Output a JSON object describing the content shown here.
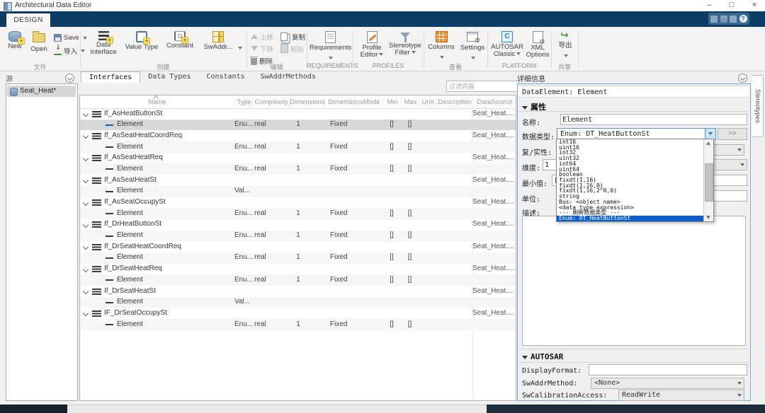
{
  "window": {
    "title": "Architectural Data Editor",
    "controls": {
      "minimize": "–",
      "maximize": "□",
      "close": "×"
    }
  },
  "ribbon": {
    "tab_label": "DESIGN",
    "groups": {
      "file": {
        "label": "文件",
        "new": "New",
        "open": "Open",
        "save": "Save",
        "import": "导入"
      },
      "create": {
        "label": "创建",
        "buttons": [
          {
            "label": "Data Interface",
            "icon": "data-interface-icon"
          },
          {
            "label": "Value Type",
            "icon": "value-type-icon"
          },
          {
            "label": "Constant",
            "icon": "constant-icon"
          },
          {
            "label": "SwAddr...",
            "icon": "swaddr-icon"
          }
        ]
      },
      "edit": {
        "label": "编辑",
        "up": "上移",
        "down": "下移",
        "copy": "复制",
        "paste": "粘贴",
        "delete": "删除"
      },
      "requirements": {
        "label": "REQUIREMENTS",
        "button": "Requirements"
      },
      "profiles": {
        "label": "PROFILES",
        "profile_editor_line1": "Profile",
        "profile_editor_line2": "Editor",
        "stereotype_filter_line1": "Stereotype",
        "stereotype_filter_line2": "Filter"
      },
      "view": {
        "label": "查看",
        "columns": "Columns",
        "settings": "Settings"
      },
      "platform": {
        "label": "PLATFORM",
        "autosar_line1": "AUTOSAR",
        "autosar_line2": "Classic",
        "xml_line1": "XML",
        "xml_line2": "Options"
      },
      "share": {
        "label": "共享",
        "export": "导出"
      }
    }
  },
  "source_panel": {
    "header": "源",
    "items": [
      {
        "label": "Seat_Heat*",
        "icon": "database-icon",
        "selected": true
      }
    ]
  },
  "doc_tabs": {
    "items": [
      "Interfaces",
      "Data Types",
      "Constants",
      "SwAddrMethods"
    ],
    "active_index": 0
  },
  "filter": {
    "placeholder": "过滤内容"
  },
  "table": {
    "columns": [
      "Name",
      "Type",
      "Complexity",
      "Dimensions",
      "DimensionsMode",
      "Min",
      "Max",
      "Unit",
      "Description",
      "DataSource"
    ],
    "rows": [
      {
        "kind": "group",
        "name": "If_AsHeatButtonSt",
        "dataSource": "Seat_Heat...."
      },
      {
        "kind": "element",
        "name": "Element",
        "type": "Enu...",
        "complexity": "real",
        "dimensions": "1",
        "dimensionsMode": "Fixed",
        "min": "[]",
        "max": "[]",
        "selected": true
      },
      {
        "kind": "group",
        "name": "If_AsSeatHeatCoordReq",
        "dataSource": "Seat_Heat...."
      },
      {
        "kind": "element",
        "name": "Element",
        "type": "Enu...",
        "complexity": "real",
        "dimensions": "1",
        "dimensionsMode": "Fixed",
        "min": "[]",
        "max": "[]"
      },
      {
        "kind": "group",
        "name": "If_AsSeatHeatReq",
        "dataSource": "Seat_Heat...."
      },
      {
        "kind": "element",
        "name": "Element",
        "type": "Enu...",
        "complexity": "real",
        "dimensions": "1",
        "dimensionsMode": "Fixed",
        "min": "[]",
        "max": "[]"
      },
      {
        "kind": "group",
        "name": "If_AsSeatHeatSt",
        "dataSource": "Seat_Heat...."
      },
      {
        "kind": "element",
        "name": "Element",
        "type": "Val..."
      },
      {
        "kind": "group",
        "name": "If_AsSeatOccupySt",
        "dataSource": "Seat_Heat...."
      },
      {
        "kind": "element",
        "name": "Element",
        "type": "Enu...",
        "complexity": "real",
        "dimensions": "1",
        "dimensionsMode": "Fixed",
        "min": "[]",
        "max": "[]"
      },
      {
        "kind": "group",
        "name": "If_DrHeatButtonSt",
        "dataSource": "Seat_Heat...."
      },
      {
        "kind": "element",
        "name": "Element",
        "type": "Enu...",
        "complexity": "real",
        "dimensions": "1",
        "dimensionsMode": "Fixed",
        "min": "[]",
        "max": "[]"
      },
      {
        "kind": "group",
        "name": "If_DrSeatHeatCoordReq",
        "dataSource": "Seat_Heat...."
      },
      {
        "kind": "element",
        "name": "Element",
        "type": "Enu...",
        "complexity": "real",
        "dimensions": "1",
        "dimensionsMode": "Fixed",
        "min": "[]",
        "max": "[]"
      },
      {
        "kind": "group",
        "name": "If_DrSeatHeatReq",
        "dataSource": "Seat_Heat...."
      },
      {
        "kind": "element",
        "name": "Element",
        "type": "Enu...",
        "complexity": "real",
        "dimensions": "1",
        "dimensionsMode": "Fixed",
        "min": "[]",
        "max": "[]"
      },
      {
        "kind": "group",
        "name": "If_DrSeatHeatSt",
        "dataSource": "Seat_Heat...."
      },
      {
        "kind": "element",
        "name": "Element",
        "type": "Val..."
      },
      {
        "kind": "group",
        "name": "IF_DrSeatOccupySt",
        "dataSource": "Seat_Heat...."
      },
      {
        "kind": "element",
        "name": "Element",
        "type": "Enu...",
        "complexity": "real",
        "dimensions": "1",
        "dimensionsMode": "Fixed",
        "min": "[]",
        "max": "[]"
      }
    ]
  },
  "details": {
    "header": "详细信息",
    "selection": "DataElement: Element",
    "properties_section": "属性",
    "fields": {
      "name_label": "名称:",
      "name_value": "Element",
      "datatype_label": "数据类型:",
      "datatype_value": "Enum: DT_HeatButtonSt",
      "expand_button": ">>",
      "complexity_label": "复/实性:",
      "dimensions_label": "维度:",
      "dimensions_value": "1",
      "min_label": "最小值:",
      "min_value": "[]",
      "unit_label": "单位:",
      "description_label": "描述:"
    },
    "autosar_section": "AUTOSAR",
    "autosar": {
      "display_format_label": "DisplayFormat:",
      "sw_addr_label": "SwAddrMethod:",
      "sw_addr_value": "<None>",
      "sw_cal_label": "SwCalibrationAccess:",
      "sw_cal_value": "ReadWrite"
    }
  },
  "datatype_dropdown": {
    "items": [
      "int16",
      "uint16",
      "int32",
      "uint32",
      "int64",
      "uint64",
      "boolean",
      "fixdt(1,16)",
      "fixdt(1,16,0)",
      "fixdt(1,16,2^0,0)",
      "string",
      "Bus: <object name>",
      "<data type expression>",
      "--- 刷新数据类型 ---",
      "Enum: DT_HeatButtonSt"
    ],
    "selected_index": 14
  },
  "side_tab": {
    "label": "Stereotypes"
  },
  "colors": {
    "accent_blue": "#0a5fd0",
    "titlebar_strip": "#0e3d63",
    "selection_gray": "#d8d8d8"
  }
}
